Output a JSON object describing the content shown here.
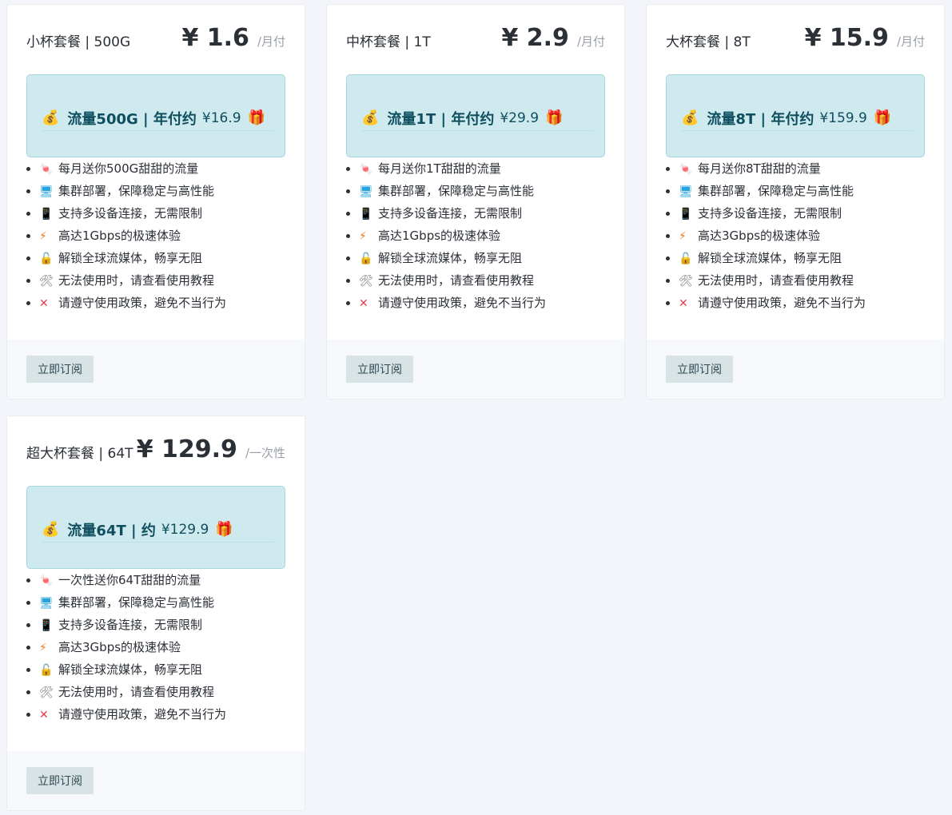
{
  "plans": [
    {
      "name": "小杯套餐 | 500G",
      "price": "¥ 1.6",
      "period": "/月付",
      "promo_text": "流量500G | 年付约",
      "promo_price": "¥16.9",
      "features": [
        "每月送你500G甜甜的流量",
        "集群部署，保障稳定与高性能",
        "支持多设备连接，无需限制",
        "高达1Gbps的极速体验",
        "解锁全球流媒体，畅享无阻",
        "无法使用时，请查看使用教程",
        "请遵守使用政策，避免不当行为"
      ],
      "button": "立即订阅"
    },
    {
      "name": "中杯套餐 | 1T",
      "price": "¥ 2.9",
      "period": "/月付",
      "promo_text": "流量1T | 年付约",
      "promo_price": "¥29.9",
      "features": [
        "每月送你1T甜甜的流量",
        "集群部署，保障稳定与高性能",
        "支持多设备连接，无需限制",
        "高达1Gbps的极速体验",
        "解锁全球流媒体，畅享无阻",
        "无法使用时，请查看使用教程",
        "请遵守使用政策，避免不当行为"
      ],
      "button": "立即订阅"
    },
    {
      "name": "大杯套餐 | 8T",
      "price": "¥ 15.9",
      "period": "/月付",
      "promo_text": "流量8T | 年付约",
      "promo_price": "¥159.9",
      "features": [
        "每月送你8T甜甜的流量",
        "集群部署，保障稳定与高性能",
        "支持多设备连接，无需限制",
        "高达3Gbps的极速体验",
        "解锁全球流媒体，畅享无阻",
        "无法使用时，请查看使用教程",
        "请遵守使用政策，避免不当行为"
      ],
      "button": "立即订阅"
    },
    {
      "name": "超大杯套餐 | 64T",
      "price": "¥ 129.9",
      "period": "/一次性",
      "promo_text": "流量64T | 约",
      "promo_price": "¥129.9",
      "features": [
        "一次性送你64T甜甜的流量",
        "集群部署，保障稳定与高性能",
        "支持多设备连接，无需限制",
        "高达3Gbps的极速体验",
        "解锁全球流媒体，畅享无阻",
        "无法使用时，请查看使用教程",
        "请遵守使用政策，避免不当行为"
      ],
      "button": "立即订阅"
    }
  ],
  "icons": {
    "promo": "money-bag-icon",
    "gift": "gift-icon",
    "features": [
      "candy-icon",
      "computer-icon",
      "phone-icon",
      "lightning-icon",
      "unlock-icon",
      "tools-icon",
      "cross-mark-icon"
    ]
  },
  "colors": {
    "page_bg": "#f4f5fa",
    "promo_bg": "#cfeaee",
    "promo_text": "#0e4e5e",
    "button_bg": "#d8e3e6"
  }
}
